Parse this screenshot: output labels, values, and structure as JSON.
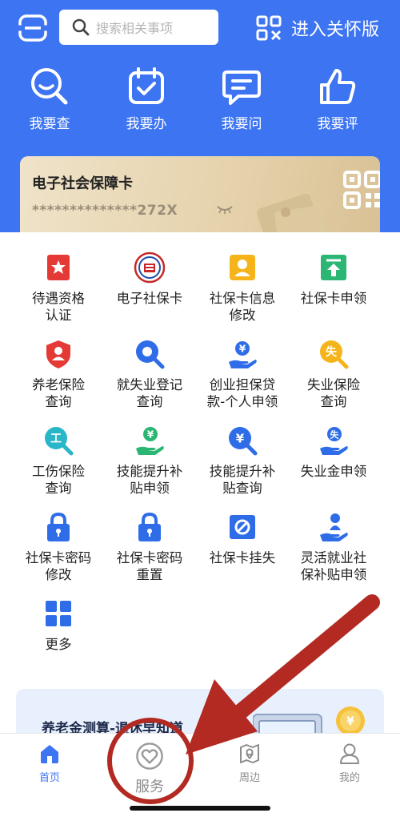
{
  "header": {
    "search_placeholder": "搜索相关事项",
    "care_mode_label": "进入关怀版",
    "quick_actions": [
      {
        "label": "我要查",
        "icon": "search-magnifier-icon"
      },
      {
        "label": "我要办",
        "icon": "calendar-check-icon"
      },
      {
        "label": "我要问",
        "icon": "chat-bubble-icon"
      },
      {
        "label": "我要评",
        "icon": "thumbs-up-icon"
      }
    ]
  },
  "social_card": {
    "title": "电子社会保障卡",
    "masked_number": "**************272X",
    "icons": [
      "eye-closed-icon",
      "qr-code-icon"
    ]
  },
  "services": [
    {
      "label": "待遇资格\n认证",
      "icon": "certificate-star-icon",
      "color": "#e53935"
    },
    {
      "label": "电子社保卡",
      "icon": "social-security-seal-icon",
      "color": "#c62828"
    },
    {
      "label": "社保卡信息\n修改",
      "icon": "id-card-person-icon",
      "color": "#f5b41a"
    },
    {
      "label": "社保卡申领",
      "icon": "upload-arrow-icon",
      "color": "#2bb673"
    },
    {
      "label": "养老保险\n查询",
      "icon": "shield-person-icon",
      "color": "#e53935"
    },
    {
      "label": "就失业登记\n查询",
      "icon": "magnifier-icon",
      "color": "#2f6de8"
    },
    {
      "label": "创业担保贷\n款-个人申领",
      "icon": "hand-person-coin-icon",
      "color": "#2f6de8"
    },
    {
      "label": "失业保险\n查询",
      "icon": "loss-search-icon",
      "color": "#f5b41a",
      "glyph": "失"
    },
    {
      "label": "工伤保险\n查询",
      "icon": "injury-search-icon",
      "color": "#29b6c8",
      "glyph": "工"
    },
    {
      "label": "技能提升补\n贴申领",
      "icon": "hand-yuan-icon",
      "color": "#2bb673"
    },
    {
      "label": "技能提升补\n贴查询",
      "icon": "yuan-search-icon",
      "color": "#2f6de8"
    },
    {
      "label": "失业金申领",
      "icon": "hand-loss-icon",
      "color": "#2f6de8",
      "glyph": "失"
    },
    {
      "label": "社保卡密码\n修改",
      "icon": "lock-icon",
      "color": "#2f6de8"
    },
    {
      "label": "社保卡密码\n重置",
      "icon": "lock-icon",
      "color": "#2f6de8"
    },
    {
      "label": "社保卡挂失",
      "icon": "block-card-icon",
      "color": "#2f6de8"
    },
    {
      "label": "灵活就业社\n保补贴申领",
      "icon": "hand-person-icon",
      "color": "#2f6de8"
    },
    {
      "label": "更多",
      "icon": "grid-more-icon",
      "color": "#2f6de8"
    }
  ],
  "banner": {
    "text": "养老金测算-退休早知道"
  },
  "tabbar": [
    {
      "label": "首页",
      "icon": "home-icon",
      "active": true
    },
    {
      "label": "服务",
      "icon": "heart-service-icon",
      "active": false
    },
    {
      "label": "周边",
      "icon": "map-pin-icon",
      "active": false
    },
    {
      "label": "我的",
      "icon": "user-icon",
      "active": false
    }
  ],
  "annotation": {
    "arrow_color": "#b22a22",
    "circle_color": "#b22a22"
  },
  "colors": {
    "brand_blue": "#3d74f2",
    "card_gold": "#e6d3ad"
  }
}
